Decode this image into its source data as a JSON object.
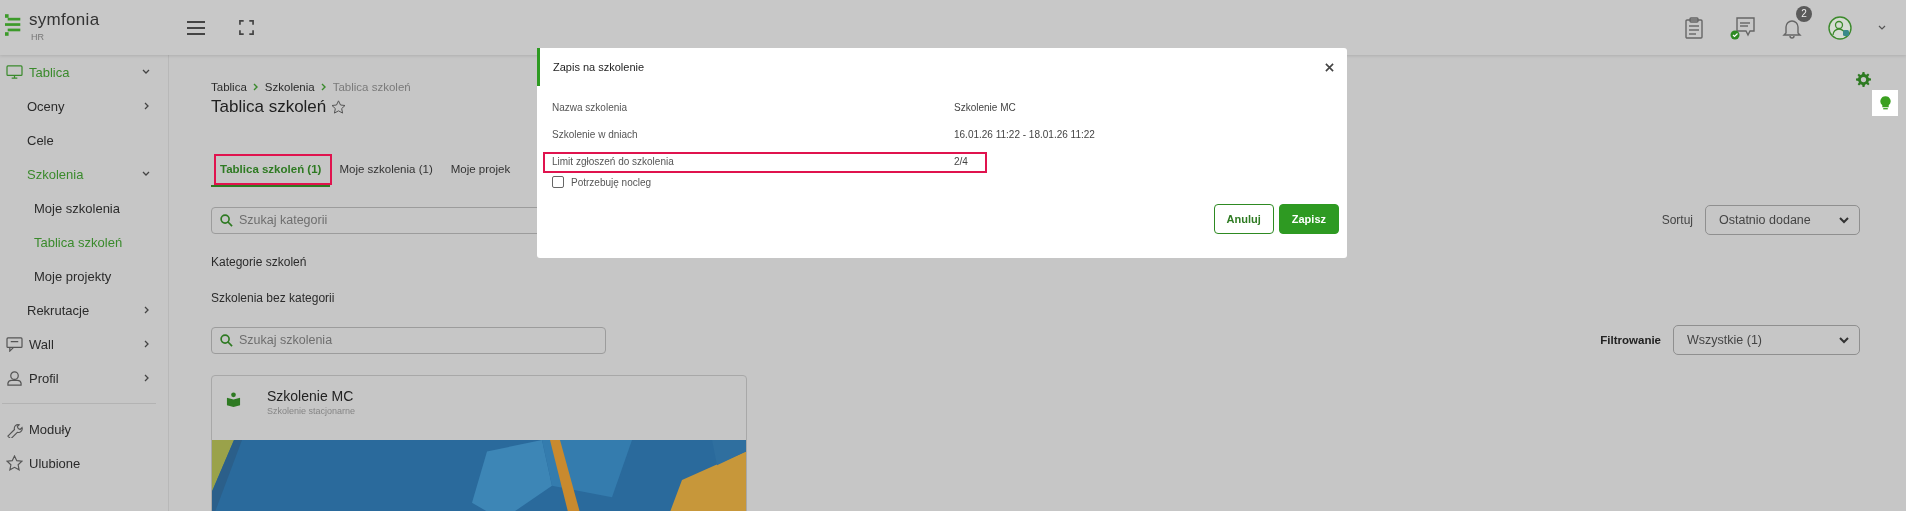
{
  "header": {
    "logo_text": "symfonia",
    "logo_sub": "HR",
    "notification_count": "2"
  },
  "sidebar": {
    "items": [
      {
        "label": "Tablica",
        "expanded": true,
        "selected": true,
        "children": [
          {
            "label": "Oceny",
            "expanded": false,
            "selected": false
          },
          {
            "label": "Cele",
            "selected": false
          },
          {
            "label": "Szkolenia",
            "expanded": true,
            "selected": true,
            "children": [
              {
                "label": "Moje szkolenia",
                "selected": false
              },
              {
                "label": "Tablica szkoleń",
                "selected": true
              },
              {
                "label": "Moje projekty",
                "selected": false
              }
            ]
          },
          {
            "label": "Rekrutacje",
            "expanded": false,
            "selected": false
          }
        ]
      },
      {
        "label": "Wall",
        "expanded": false,
        "selected": false
      },
      {
        "label": "Profil",
        "expanded": false,
        "selected": false
      }
    ],
    "bottom_items": [
      {
        "label": "Moduły"
      },
      {
        "label": "Ulubione"
      }
    ]
  },
  "breadcrumb": [
    "Tablica",
    "Szkolenia",
    "Tablica szkoleń"
  ],
  "page_title": "Tablica szkoleń",
  "tabs": [
    {
      "label": "Tablica szkoleń (1)",
      "selected": true,
      "highlighted": true
    },
    {
      "label": "Moje szkolenia (1)",
      "selected": false,
      "highlighted": false
    },
    {
      "label": "Moje projek",
      "selected": false,
      "highlighted": false
    }
  ],
  "category_search": {
    "placeholder": "Szukaj kategorii"
  },
  "sort": {
    "label": "Sortuj",
    "value": "Ostatnio dodane"
  },
  "sections": [
    "Kategorie szkoleń",
    "Szkolenia bez kategorii"
  ],
  "training_search": {
    "placeholder": "Szukaj szkolenia"
  },
  "filter": {
    "label": "Filtrowanie",
    "value": "Wszystkie (1)"
  },
  "cards": [
    {
      "title": "Szkolenie MC",
      "subtitle": "Szkolenie stacjonarne",
      "kind": "picture"
    }
  ],
  "modal": {
    "title": "Zapis na szkolenie",
    "fields": [
      {
        "label": "Nazwa szkolenia",
        "value": "Szkolenie MC",
        "highlighted": false
      },
      {
        "label": "Szkolenie w dniach",
        "value": "16.01.26 11:22 - 18.01.26 11:22",
        "highlighted": false
      },
      {
        "label": "Limit zgłoszeń do szkolenia",
        "value": "2/4",
        "highlighted": true
      }
    ],
    "checkbox": {
      "label": "Potrzebuję nocleg",
      "checked": false
    },
    "buttons": [
      {
        "label": "Anuluj",
        "kind": "secondary"
      },
      {
        "label": "Zapisz",
        "kind": "primary"
      }
    ]
  }
}
